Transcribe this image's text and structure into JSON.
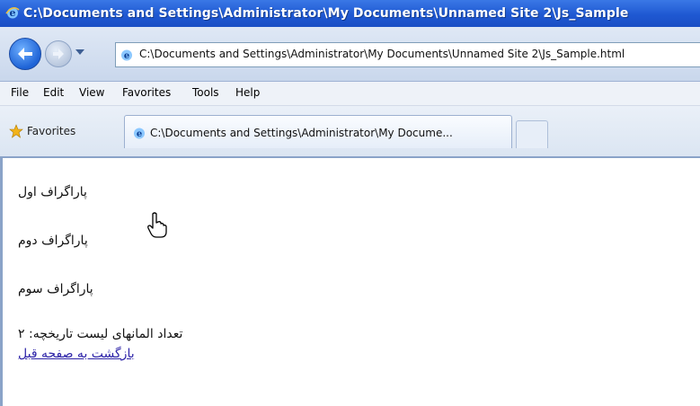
{
  "window": {
    "title": "C:\\Documents and Settings\\Administrator\\My Documents\\Unnamed Site 2\\Js_Sample"
  },
  "navigation": {
    "back_icon": "back-arrow-icon",
    "forward_icon": "forward-arrow-icon",
    "address": "C:\\Documents and Settings\\Administrator\\My Documents\\Unnamed Site 2\\Js_Sample.html"
  },
  "menu": {
    "items": [
      "File",
      "Edit",
      "View",
      "Favorites",
      "Tools",
      "Help"
    ]
  },
  "favorites_bar": {
    "label": "Favorites",
    "tab_title": "C:\\Documents and Settings\\Administrator\\My Docume..."
  },
  "page": {
    "paragraph_1": "پاراگراف اول",
    "paragraph_2": "پاراگراف دوم",
    "paragraph_3": "پاراگراف سوم",
    "count_text": "تعداد المانهای لیست تاریخچه: ۲",
    "back_link": "بازگشت به صفحه قبل"
  },
  "colors": {
    "titlebar": "#1f58d2",
    "link": "#2d23a8",
    "toolbar": "#dfe8f5"
  }
}
